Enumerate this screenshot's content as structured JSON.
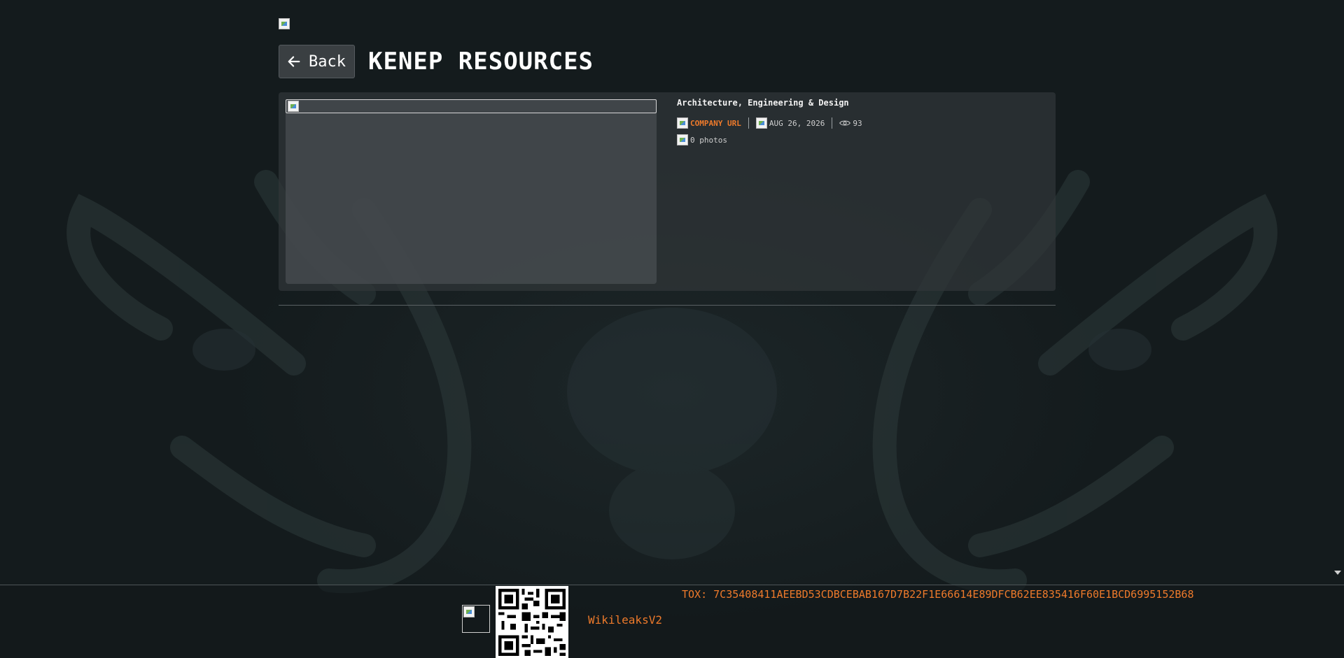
{
  "header": {
    "logo_icon": "broken-image-icon",
    "back_label": "Back",
    "title": "KENEP RESOURCES"
  },
  "company": {
    "category": "Architecture, Engineering & Design",
    "company_url_label": "COMPANY URL",
    "date": "AUG 26, 2026",
    "views": "93",
    "photos": "0 photos"
  },
  "footer": {
    "link_label": "WikileaksV2",
    "tox": "TOX: 7C35408411AEEBD53CDBCEBAB167D7B22F1E66614E89DFCB62EE835416F60E1BCD6995152B68"
  },
  "colors": {
    "background": "#141b1d",
    "accent": "#ee7a2b",
    "card": "#303639"
  }
}
